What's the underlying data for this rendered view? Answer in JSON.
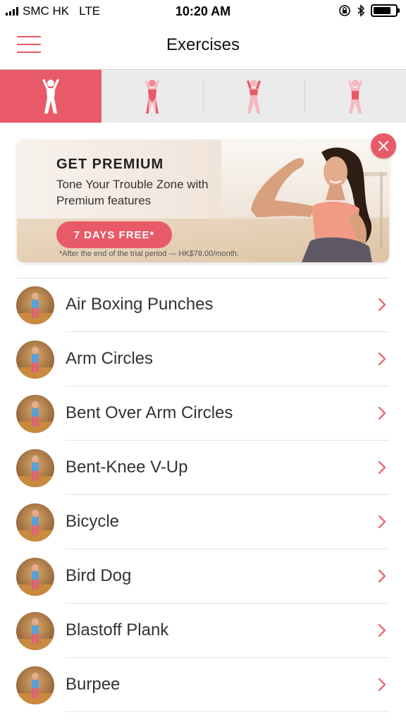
{
  "status_bar": {
    "carrier": "SMC HK",
    "network": "LTE",
    "time": "10:20 AM"
  },
  "header": {
    "title": "Exercises"
  },
  "category_tabs": [
    {
      "name": "full-body",
      "active": true
    },
    {
      "name": "upper-body",
      "active": false
    },
    {
      "name": "arms",
      "active": false
    },
    {
      "name": "core",
      "active": false
    }
  ],
  "promo": {
    "title": "GET PREMIUM",
    "subtitle": "Tone Your Trouble Zone with Premium features",
    "cta_label": "7 DAYS FREE*",
    "note": "*After the end of the trial period — HK$78.00/month."
  },
  "exercises": [
    {
      "name": "Air Boxing Punches",
      "thumb": "exercise-thumb"
    },
    {
      "name": "Arm Circles",
      "thumb": "exercise-thumb"
    },
    {
      "name": "Bent Over Arm Circles",
      "thumb": "exercise-thumb"
    },
    {
      "name": "Bent-Knee V-Up",
      "thumb": "exercise-thumb"
    },
    {
      "name": "Bicycle",
      "thumb": "exercise-thumb"
    },
    {
      "name": "Bird Dog",
      "thumb": "exercise-thumb"
    },
    {
      "name": "Blastoff Plank",
      "thumb": "exercise-thumb"
    },
    {
      "name": "Burpee",
      "thumb": "exercise-thumb"
    }
  ],
  "colors": {
    "accent": "#e95a68",
    "tab_bg": "#ebebeb",
    "text": "#333333"
  }
}
